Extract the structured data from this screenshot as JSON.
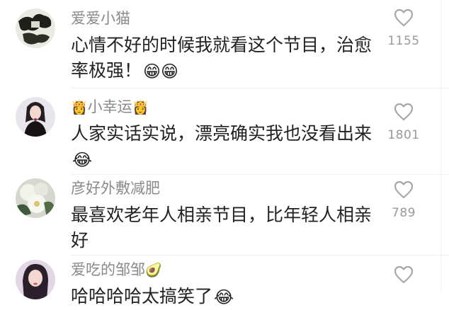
{
  "comments": [
    {
      "username": "爱爱小猫",
      "text": "心情不好的时候我就看这个节目，治愈率极强！",
      "emojis": "😁😁",
      "like_count": "1155"
    },
    {
      "username_prefix_emoji": "👸",
      "username": "小幸运",
      "username_suffix_emoji": "👸",
      "text": "人家实话实说，漂亮确实我也没看出来",
      "emojis": "😂",
      "like_count": "1801"
    },
    {
      "username": "彦好外敷减肥",
      "text": "最喜欢老年人相亲节目，比年轻人相亲好",
      "like_count": "789"
    },
    {
      "username": "爱吃的邹邹",
      "username_suffix_emoji": "🥑",
      "text": "哈哈哈哈太搞笑了",
      "emojis": "😂"
    }
  ],
  "icons": {
    "like": "heart-outline-icon"
  },
  "colors": {
    "username": "#8a8a8a",
    "text": "#222222",
    "count": "#9a9a9a"
  }
}
